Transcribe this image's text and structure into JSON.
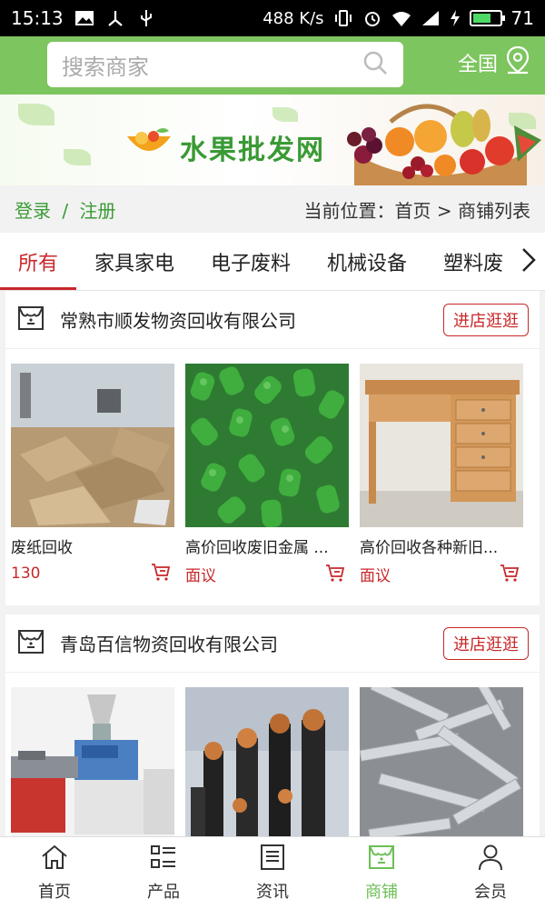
{
  "status_bar": {
    "time": "15:13",
    "speed": "488 K/s",
    "battery": "71",
    "battery_level": 0.71
  },
  "search": {
    "placeholder": "搜索商家"
  },
  "region": {
    "label": "全国"
  },
  "banner": {
    "title": "水果批发网"
  },
  "infobar": {
    "login": "登录",
    "separator": "/",
    "register": "注册",
    "breadcrumb": "当前位置：首页 > 商铺列表"
  },
  "tabs": [
    {
      "label": "所有",
      "active": true
    },
    {
      "label": "家具家电"
    },
    {
      "label": "电子废料"
    },
    {
      "label": "机械设备"
    },
    {
      "label": "塑料废"
    }
  ],
  "stores": [
    {
      "name": "常熟市顺发物资回收有限公司",
      "visit_label": "进店逛逛",
      "products": [
        {
          "name": "废纸回收",
          "price": "130"
        },
        {
          "name": "高价回收废旧金属 ...",
          "price": "面议"
        },
        {
          "name": "高价回收各种新旧...",
          "price": "面议"
        }
      ]
    },
    {
      "name": "青岛百信物资回收有限公司",
      "visit_label": "进店逛逛",
      "products": [
        {
          "name": "",
          "price": ""
        },
        {
          "name": "",
          "price": ""
        },
        {
          "name": "",
          "price": ""
        }
      ]
    }
  ],
  "bottom_nav": [
    {
      "label": "首页",
      "icon": "home-icon"
    },
    {
      "label": "产品",
      "icon": "grid-list-icon"
    },
    {
      "label": "资讯",
      "icon": "news-icon"
    },
    {
      "label": "商铺",
      "icon": "store-icon",
      "active": true
    },
    {
      "label": "会员",
      "icon": "user-icon"
    }
  ],
  "colors": {
    "header": "#7dc55f",
    "accent_red": "#c8282a",
    "accent_green": "#3a9a34",
    "nav_active": "#6cbf55"
  }
}
